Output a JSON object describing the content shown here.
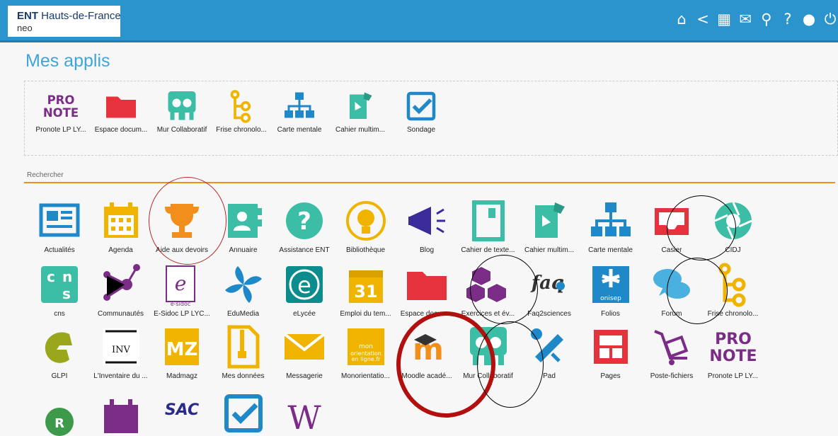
{
  "header": {
    "logo_ent": "ENT",
    "logo_region": "Hauts-de-France",
    "logo_sub": "neo"
  },
  "top_icons": [
    "home-icon",
    "share-icon",
    "grid-icon",
    "mail-icon",
    "search-icon",
    "help-icon",
    "user-icon",
    "power-icon"
  ],
  "page_title": "Mes applis",
  "favorites": [
    "Pronote LP LY...",
    "Espace docum...",
    "Mur Collaboratif",
    "Frise chronolo...",
    "Carte mentale",
    "Cahier multim...",
    "Sondage"
  ],
  "search": {
    "placeholder": "Rechercher"
  },
  "apps": [
    [
      "Actualités",
      "Agenda",
      "Aide aux devoirs",
      "Annuaire",
      "Assistance ENT",
      "Bibliothèque",
      "Blog",
      "Cahier de texte...",
      "Cahier multim...",
      "Carte mentale",
      "Casier",
      "CIDJ"
    ],
    [
      "cns",
      "Communautés",
      "E-Sidoc LP LYC...",
      "EduMedia",
      "eLycée",
      "Emploi du tem...",
      "Espace docum...",
      "Exercices et év...",
      "Faq2sciences",
      "Folios",
      "Forum",
      "Frise chronolo..."
    ],
    [
      "GLPI",
      "L'Inventaire du ...",
      "Madmagz",
      "Mes données",
      "Messagerie",
      "Monorientatio...",
      "Moodle acadé...",
      "Mur Collaboratif",
      "Pad",
      "Pages",
      "Poste-fichiers",
      "Pronote LP LY..."
    ],
    [
      "",
      "",
      "",
      "",
      "",
      ""
    ]
  ],
  "icon_text": {
    "pronote": [
      "PRO",
      "NOTE"
    ],
    "cns": [
      "c",
      "n",
      "s"
    ],
    "esidoc": "e-sidoc",
    "elycee": "e",
    "edt": "31",
    "faq": "faq",
    "folios": "onisep",
    "mz": "MZ",
    "monori": [
      "mon",
      "orientation",
      "en ligne.fr"
    ],
    "sac": "SAC",
    "calendar": "",
    "moodle": "m"
  },
  "colors": {
    "header": "#2b94cc",
    "accent": "#f28e1b",
    "title": "#3fa5d9"
  }
}
